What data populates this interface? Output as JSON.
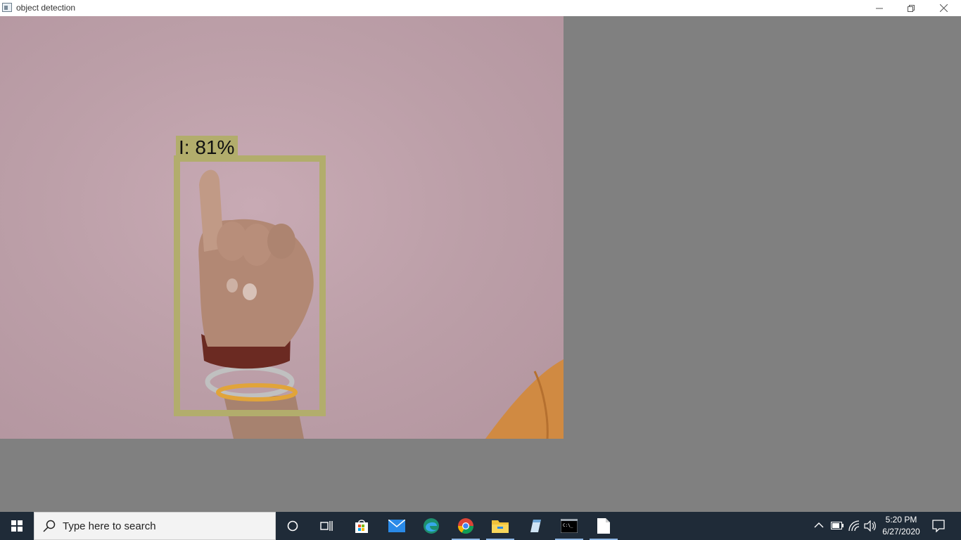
{
  "window": {
    "title": "object detection",
    "controls": {
      "minimize_icon": "minimize-icon",
      "maximize_icon": "restore-icon",
      "close_icon": "close-icon"
    }
  },
  "detection": {
    "label": "I: 81%",
    "box_color": "#b2ad6c"
  },
  "taskbar": {
    "search_placeholder": "Type here to search",
    "pinned": [
      {
        "name": "cortana",
        "icon": "circle-icon"
      },
      {
        "name": "task-view",
        "icon": "task-view-icon"
      },
      {
        "name": "store",
        "icon": "store-icon"
      },
      {
        "name": "mail",
        "icon": "mail-icon"
      },
      {
        "name": "edge",
        "icon": "edge-icon"
      },
      {
        "name": "chrome",
        "icon": "chrome-icon"
      },
      {
        "name": "file-explorer",
        "icon": "folder-icon"
      },
      {
        "name": "app",
        "icon": "app-icon"
      },
      {
        "name": "command-prompt",
        "icon": "terminal-icon"
      },
      {
        "name": "notepad",
        "icon": "document-icon"
      }
    ],
    "clock": {
      "time": "5:20 PM",
      "date": "6/27/2020"
    }
  }
}
